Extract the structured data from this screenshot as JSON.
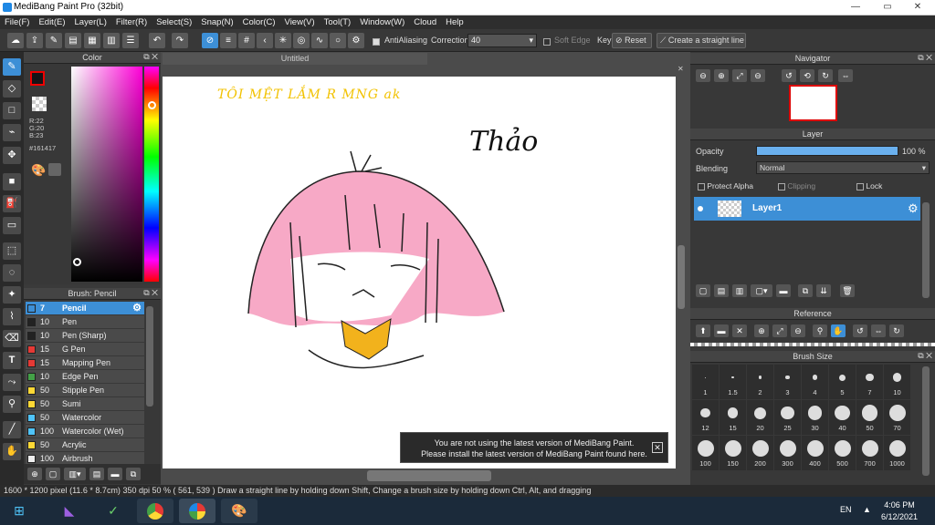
{
  "window": {
    "title": "MediBang Paint Pro (32bit)",
    "min": "—",
    "max": "▭",
    "close": "✕"
  },
  "menu": [
    "File(F)",
    "Edit(E)",
    "Layer(L)",
    "Filter(R)",
    "Select(S)",
    "Snap(N)",
    "Color(C)",
    "View(V)",
    "Tool(T)",
    "Window(W)",
    "Cloud",
    "Help"
  ],
  "toolbar": {
    "antialiasing": "AntiAliasing",
    "correction_label": "Correction",
    "correction_value": "40",
    "soft_edge": "Soft Edge",
    "key": "Key",
    "reset": "Reset",
    "straight_line": "Create a straight line"
  },
  "color_panel": {
    "title": "Color",
    "r": "R:22",
    "g": "G:20",
    "b": "B:23",
    "hex": "#161417",
    "fg_color": "#161417",
    "bg_color": "#ffffff"
  },
  "brush_panel": {
    "title": "Brush: Pencil",
    "items": [
      {
        "size": "7",
        "name": "Pencil",
        "color": "#3d8fd6"
      },
      {
        "size": "10",
        "name": "Pen",
        "color": "#222222"
      },
      {
        "size": "10",
        "name": "Pen (Sharp)",
        "color": "#222222"
      },
      {
        "size": "15",
        "name": "G Pen",
        "color": "#e53935"
      },
      {
        "size": "15",
        "name": "Mapping Pen",
        "color": "#e53935"
      },
      {
        "size": "10",
        "name": "Edge Pen",
        "color": "#43a047"
      },
      {
        "size": "50",
        "name": "Stipple Pen",
        "color": "#fdd835"
      },
      {
        "size": "50",
        "name": "Sumi",
        "color": "#fdd835"
      },
      {
        "size": "50",
        "name": "Watercolor",
        "color": "#4fc3f7"
      },
      {
        "size": "100",
        "name": "Watercolor (Wet)",
        "color": "#4fc3f7"
      },
      {
        "size": "50",
        "name": "Acrylic",
        "color": "#fdd835"
      },
      {
        "size": "100",
        "name": "Airbrush",
        "color": "#eeeeee"
      }
    ]
  },
  "canvas": {
    "tab": "Untitled",
    "handwriting_yellow": "TÔI MỆT LẮM R MNG ak",
    "signature": "Thảo"
  },
  "notification": {
    "line1": "You are not using the latest version of MediBang Paint.",
    "line2": "Please install the latest version of MediBang Paint found here.",
    "close": "✕"
  },
  "navigator": {
    "title": "Navigator"
  },
  "layer_panel": {
    "title": "Layer",
    "opacity_label": "Opacity",
    "opacity_value": "100 %",
    "opacity_fraction": 1.0,
    "blending_label": "Blending",
    "blending_value": "Normal",
    "protect_alpha": "Protect Alpha",
    "clipping": "Clipping",
    "lock": "Lock",
    "layer_name": "Layer1"
  },
  "reference": {
    "title": "Reference"
  },
  "brush_size": {
    "title": "Brush Size",
    "sizes": [
      "1",
      "1.5",
      "2",
      "3",
      "4",
      "5",
      "7",
      "10",
      "12",
      "15",
      "20",
      "25",
      "30",
      "40",
      "50",
      "70",
      "100",
      "150",
      "200",
      "300",
      "400",
      "500",
      "700",
      "1000"
    ]
  },
  "status": {
    "size": "1600 * 1200 pixel",
    "cm": "(11.6 * 8.7cm)",
    "dpi": "350 dpi",
    "zoom": "50 %",
    "coords": "( 561, 539 )",
    "hint": "Draw a straight line by holding down Shift, Change a brush size by holding down Ctrl, Alt, and dragging"
  },
  "taskbar": {
    "lang": "EN",
    "time": "4:06 PM",
    "date": "6/12/2021"
  }
}
